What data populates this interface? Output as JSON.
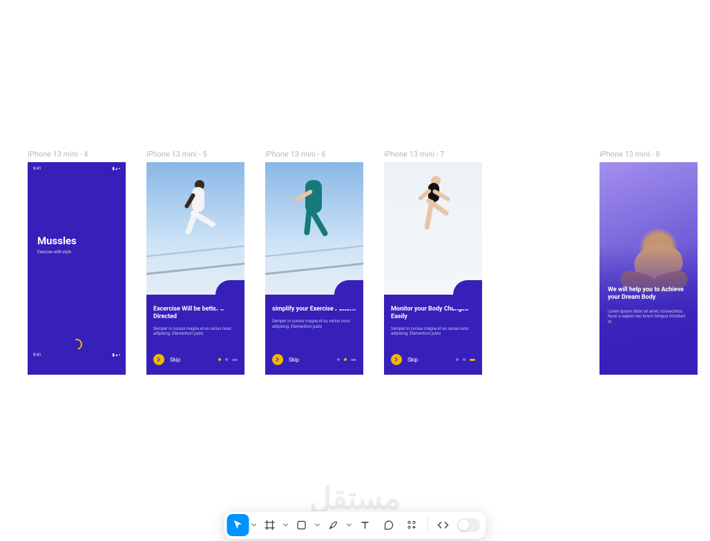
{
  "frames": [
    {
      "id": "frame-4",
      "label": "iPhone 13 mini - 4",
      "status_time": "9:41",
      "status_icons": "▮ ▴ ▪",
      "title": "Mussles",
      "subtitle": "Exercise with style"
    },
    {
      "id": "frame-5",
      "label": "iPhone 13 mini - 5",
      "card_title": "Excercise Will be better if Directed",
      "card_body": "Semper in cursus magna et eu varius nunc adipising. Elementum justo",
      "skip": "Skip",
      "active_dot": 0
    },
    {
      "id": "frame-6",
      "label": "iPhone 13 mini - 6",
      "card_title": "simplify your Exercise Pattern",
      "card_body": "Semper in cursus magna et eu varius nunc adipising. Elementum justo",
      "skip": "Skip",
      "active_dot": 1
    },
    {
      "id": "frame-7",
      "label": "iPhone 13 mini - 7",
      "card_title": "Monitor your Body Changes Easily",
      "card_body": "Semper in cursus magna et eu varius nunc adipising. Elementum justo",
      "skip": "Skip",
      "active_dot": 2
    },
    {
      "id": "frame-8",
      "label": "iPhone 13 mini - 8",
      "title": "We will help you to Achieve your Dream Body",
      "body": "Lorem ipsum dolor sit amet, consectetur. Nunc a sapien nec lorem tempus tincidunt et."
    }
  ],
  "toolbar": {
    "tools": [
      "move",
      "frame",
      "shape",
      "pen",
      "text",
      "comment",
      "plugin",
      "dev"
    ],
    "selected": "move",
    "dev_toggle": false
  },
  "watermark": "مستقل"
}
